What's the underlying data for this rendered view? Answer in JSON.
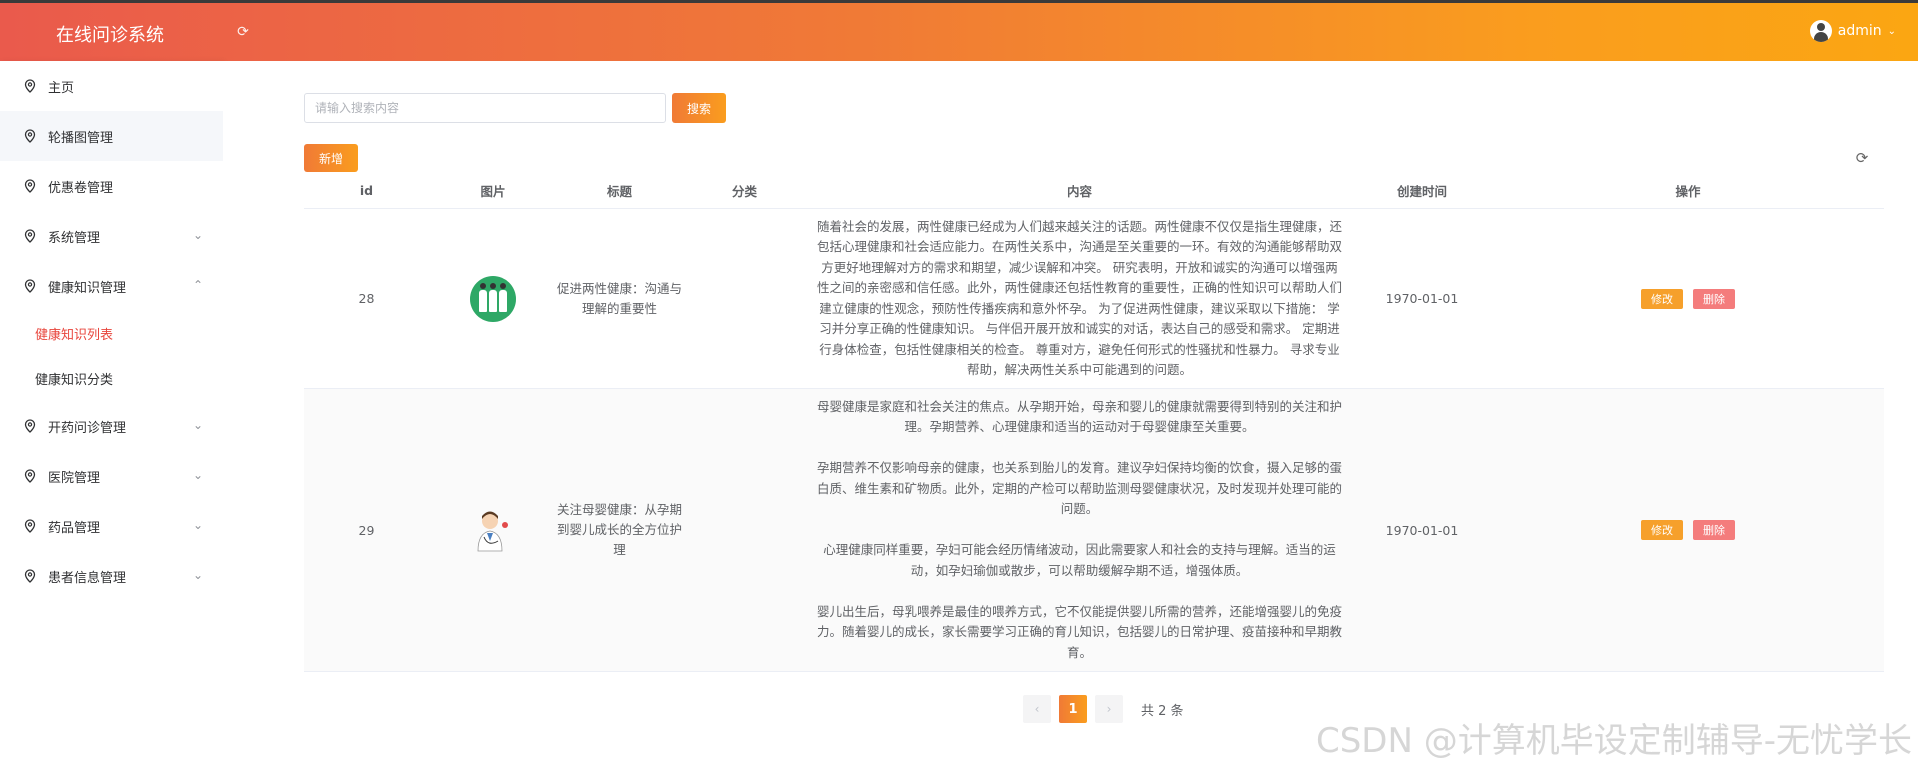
{
  "app": {
    "title": "在线问诊系统",
    "username": "admin"
  },
  "sidebar": {
    "items": [
      {
        "label": "主页"
      },
      {
        "label": "轮播图管理"
      },
      {
        "label": "优惠卷管理"
      },
      {
        "label": "系统管理"
      },
      {
        "label": "健康知识管理"
      },
      {
        "label": "开药问诊管理"
      },
      {
        "label": "医院管理"
      },
      {
        "label": "药品管理"
      },
      {
        "label": "患者信息管理"
      }
    ],
    "subitems": [
      {
        "label": "健康知识列表"
      },
      {
        "label": "健康知识分类"
      }
    ]
  },
  "search": {
    "placeholder": "请输入搜索内容",
    "button": "搜索"
  },
  "toolbar": {
    "add_label": "新增"
  },
  "table": {
    "columns": [
      "id",
      "图片",
      "标题",
      "分类",
      "内容",
      "创建时间",
      "操作"
    ],
    "rows": [
      {
        "id": "28",
        "image_icon": "doctors-group-icon",
        "title": "促进两性健康：沟通与理解的重要性",
        "category": "",
        "content": "随着社会的发展，两性健康已经成为人们越来越关注的话题。两性健康不仅仅是指生理健康，还包括心理健康和社会适应能力。在两性关系中，沟通是至关重要的一环。有效的沟通能够帮助双方更好地理解对方的需求和期望，减少误解和冲突。 研究表明，开放和诚实的沟通可以增强两性之间的亲密感和信任感。此外，两性健康还包括性教育的重要性，正确的性知识可以帮助人们建立健康的性观念，预防性传播疾病和意外怀孕。 为了促进两性健康，建议采取以下措施： 学习并分享正确的性健康知识。 与伴侣开展开放和诚实的对话，表达自己的感受和需求。 定期进行身体检查，包括性健康相关的检查。 尊重对方，避免任何形式的性骚扰和性暴力。 寻求专业帮助，解决两性关系中可能遇到的问题。",
        "date": "1970-01-01",
        "edit": "修改",
        "delete": "删除"
      },
      {
        "id": "29",
        "image_icon": "doctor-cartoon-icon",
        "title": "关注母婴健康：从孕期到婴儿成长的全方位护理",
        "category": "",
        "content": "母婴健康是家庭和社会关注的焦点。从孕期开始，母亲和婴儿的健康就需要得到特别的关注和护理。孕期营养、心理健康和适当的运动对于母婴健康至关重要。\n\n孕期营养不仅影响母亲的健康，也关系到胎儿的发育。建议孕妇保持均衡的饮食，摄入足够的蛋白质、维生素和矿物质。此外，定期的产检可以帮助监测母婴健康状况，及时发现并处理可能的问题。\n\n心理健康同样重要，孕妇可能会经历情绪波动，因此需要家人和社会的支持与理解。适当的运动，如孕妇瑜伽或散步，可以帮助缓解孕期不适，增强体质。\n\n婴儿出生后，母乳喂养是最佳的喂养方式，它不仅能提供婴儿所需的营养，还能增强婴儿的免疫力。随着婴儿的成长，家长需要学习正确的育儿知识，包括婴儿的日常护理、疫苗接种和早期教育。",
        "date": "1970-01-01",
        "edit": "修改",
        "delete": "删除"
      }
    ]
  },
  "pagination": {
    "current": "1",
    "total_text": "共 2 条",
    "prev": "‹",
    "next": "›"
  },
  "watermark": "CSDN @计算机毕设定制辅导-无忧学长"
}
